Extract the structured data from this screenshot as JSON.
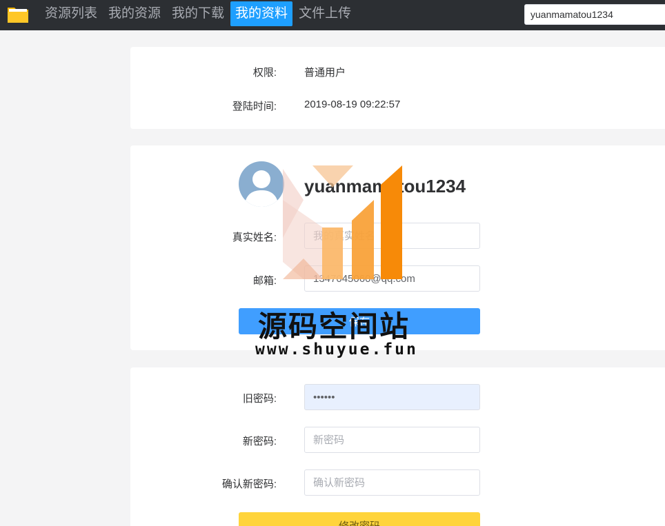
{
  "nav": {
    "items": [
      {
        "label": "资源列表",
        "active": false
      },
      {
        "label": "我的资源",
        "active": false
      },
      {
        "label": "我的下载",
        "active": false
      },
      {
        "label": "我的资料",
        "active": true
      },
      {
        "label": "文件上传",
        "active": false
      }
    ],
    "search_value": "yuanmamatou1234"
  },
  "account": {
    "role_label": "权限:",
    "role_value": "普通用户",
    "login_label": "登陆时间:",
    "login_value": "2019-08-19 09:22:57"
  },
  "profile": {
    "username": "yuanmamatou1234",
    "realname_label": "真实姓名:",
    "realname_placeholder": "我的真实姓名",
    "email_label": "邮箱:",
    "email_value": "1347045060@qq.com",
    "save_label": "保存"
  },
  "password": {
    "old_label": "旧密码:",
    "old_value": "••••••",
    "new_label": "新密码:",
    "new_placeholder": "新密码",
    "confirm_label": "确认新密码:",
    "confirm_placeholder": "确认新密码",
    "submit_label": "修改密码"
  },
  "watermark": {
    "title": "源码空间站",
    "url": "www.shuyue.fun"
  },
  "colors": {
    "nav_bg": "#2c2f33",
    "nav_active": "#1e9fff",
    "btn_blue": "#409eff",
    "btn_yellow": "#ffd43b"
  }
}
